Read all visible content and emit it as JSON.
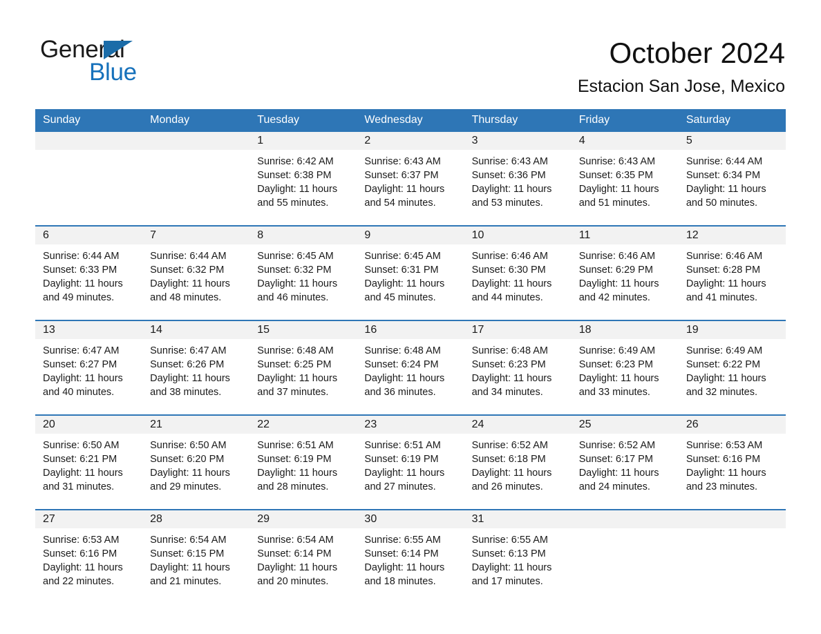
{
  "brand": {
    "name_part1": "General",
    "name_part2": "Blue",
    "triangle_color": "#1b6ca8",
    "accent_color": "#1671bb"
  },
  "header": {
    "month_title": "October 2024",
    "location": "Estacion San Jose, Mexico",
    "header_bg_color": "#2e76b6",
    "daynum_band_color": "#f2f2f2"
  },
  "weekday_headers": [
    "Sunday",
    "Monday",
    "Tuesday",
    "Wednesday",
    "Thursday",
    "Friday",
    "Saturday"
  ],
  "labels": {
    "sunrise_prefix": "Sunrise:",
    "sunset_prefix": "Sunset:",
    "daylight_prefix": "Daylight:"
  },
  "weeks": [
    [
      {
        "day": "",
        "empty": true
      },
      {
        "day": "",
        "empty": true
      },
      {
        "day": "1",
        "sunrise": "Sunrise: 6:42 AM",
        "sunset": "Sunset: 6:38 PM",
        "daylight": "Daylight: 11 hours and 55 minutes."
      },
      {
        "day": "2",
        "sunrise": "Sunrise: 6:43 AM",
        "sunset": "Sunset: 6:37 PM",
        "daylight": "Daylight: 11 hours and 54 minutes."
      },
      {
        "day": "3",
        "sunrise": "Sunrise: 6:43 AM",
        "sunset": "Sunset: 6:36 PM",
        "daylight": "Daylight: 11 hours and 53 minutes."
      },
      {
        "day": "4",
        "sunrise": "Sunrise: 6:43 AM",
        "sunset": "Sunset: 6:35 PM",
        "daylight": "Daylight: 11 hours and 51 minutes."
      },
      {
        "day": "5",
        "sunrise": "Sunrise: 6:44 AM",
        "sunset": "Sunset: 6:34 PM",
        "daylight": "Daylight: 11 hours and 50 minutes."
      }
    ],
    [
      {
        "day": "6",
        "sunrise": "Sunrise: 6:44 AM",
        "sunset": "Sunset: 6:33 PM",
        "daylight": "Daylight: 11 hours and 49 minutes."
      },
      {
        "day": "7",
        "sunrise": "Sunrise: 6:44 AM",
        "sunset": "Sunset: 6:32 PM",
        "daylight": "Daylight: 11 hours and 48 minutes."
      },
      {
        "day": "8",
        "sunrise": "Sunrise: 6:45 AM",
        "sunset": "Sunset: 6:32 PM",
        "daylight": "Daylight: 11 hours and 46 minutes."
      },
      {
        "day": "9",
        "sunrise": "Sunrise: 6:45 AM",
        "sunset": "Sunset: 6:31 PM",
        "daylight": "Daylight: 11 hours and 45 minutes."
      },
      {
        "day": "10",
        "sunrise": "Sunrise: 6:46 AM",
        "sunset": "Sunset: 6:30 PM",
        "daylight": "Daylight: 11 hours and 44 minutes."
      },
      {
        "day": "11",
        "sunrise": "Sunrise: 6:46 AM",
        "sunset": "Sunset: 6:29 PM",
        "daylight": "Daylight: 11 hours and 42 minutes."
      },
      {
        "day": "12",
        "sunrise": "Sunrise: 6:46 AM",
        "sunset": "Sunset: 6:28 PM",
        "daylight": "Daylight: 11 hours and 41 minutes."
      }
    ],
    [
      {
        "day": "13",
        "sunrise": "Sunrise: 6:47 AM",
        "sunset": "Sunset: 6:27 PM",
        "daylight": "Daylight: 11 hours and 40 minutes."
      },
      {
        "day": "14",
        "sunrise": "Sunrise: 6:47 AM",
        "sunset": "Sunset: 6:26 PM",
        "daylight": "Daylight: 11 hours and 38 minutes."
      },
      {
        "day": "15",
        "sunrise": "Sunrise: 6:48 AM",
        "sunset": "Sunset: 6:25 PM",
        "daylight": "Daylight: 11 hours and 37 minutes."
      },
      {
        "day": "16",
        "sunrise": "Sunrise: 6:48 AM",
        "sunset": "Sunset: 6:24 PM",
        "daylight": "Daylight: 11 hours and 36 minutes."
      },
      {
        "day": "17",
        "sunrise": "Sunrise: 6:48 AM",
        "sunset": "Sunset: 6:23 PM",
        "daylight": "Daylight: 11 hours and 34 minutes."
      },
      {
        "day": "18",
        "sunrise": "Sunrise: 6:49 AM",
        "sunset": "Sunset: 6:23 PM",
        "daylight": "Daylight: 11 hours and 33 minutes."
      },
      {
        "day": "19",
        "sunrise": "Sunrise: 6:49 AM",
        "sunset": "Sunset: 6:22 PM",
        "daylight": "Daylight: 11 hours and 32 minutes."
      }
    ],
    [
      {
        "day": "20",
        "sunrise": "Sunrise: 6:50 AM",
        "sunset": "Sunset: 6:21 PM",
        "daylight": "Daylight: 11 hours and 31 minutes."
      },
      {
        "day": "21",
        "sunrise": "Sunrise: 6:50 AM",
        "sunset": "Sunset: 6:20 PM",
        "daylight": "Daylight: 11 hours and 29 minutes."
      },
      {
        "day": "22",
        "sunrise": "Sunrise: 6:51 AM",
        "sunset": "Sunset: 6:19 PM",
        "daylight": "Daylight: 11 hours and 28 minutes."
      },
      {
        "day": "23",
        "sunrise": "Sunrise: 6:51 AM",
        "sunset": "Sunset: 6:19 PM",
        "daylight": "Daylight: 11 hours and 27 minutes."
      },
      {
        "day": "24",
        "sunrise": "Sunrise: 6:52 AM",
        "sunset": "Sunset: 6:18 PM",
        "daylight": "Daylight: 11 hours and 26 minutes."
      },
      {
        "day": "25",
        "sunrise": "Sunrise: 6:52 AM",
        "sunset": "Sunset: 6:17 PM",
        "daylight": "Daylight: 11 hours and 24 minutes."
      },
      {
        "day": "26",
        "sunrise": "Sunrise: 6:53 AM",
        "sunset": "Sunset: 6:16 PM",
        "daylight": "Daylight: 11 hours and 23 minutes."
      }
    ],
    [
      {
        "day": "27",
        "sunrise": "Sunrise: 6:53 AM",
        "sunset": "Sunset: 6:16 PM",
        "daylight": "Daylight: 11 hours and 22 minutes."
      },
      {
        "day": "28",
        "sunrise": "Sunrise: 6:54 AM",
        "sunset": "Sunset: 6:15 PM",
        "daylight": "Daylight: 11 hours and 21 minutes."
      },
      {
        "day": "29",
        "sunrise": "Sunrise: 6:54 AM",
        "sunset": "Sunset: 6:14 PM",
        "daylight": "Daylight: 11 hours and 20 minutes."
      },
      {
        "day": "30",
        "sunrise": "Sunrise: 6:55 AM",
        "sunset": "Sunset: 6:14 PM",
        "daylight": "Daylight: 11 hours and 18 minutes."
      },
      {
        "day": "31",
        "sunrise": "Sunrise: 6:55 AM",
        "sunset": "Sunset: 6:13 PM",
        "daylight": "Daylight: 11 hours and 17 minutes."
      },
      {
        "day": "",
        "empty": true
      },
      {
        "day": "",
        "empty": true
      }
    ]
  ]
}
